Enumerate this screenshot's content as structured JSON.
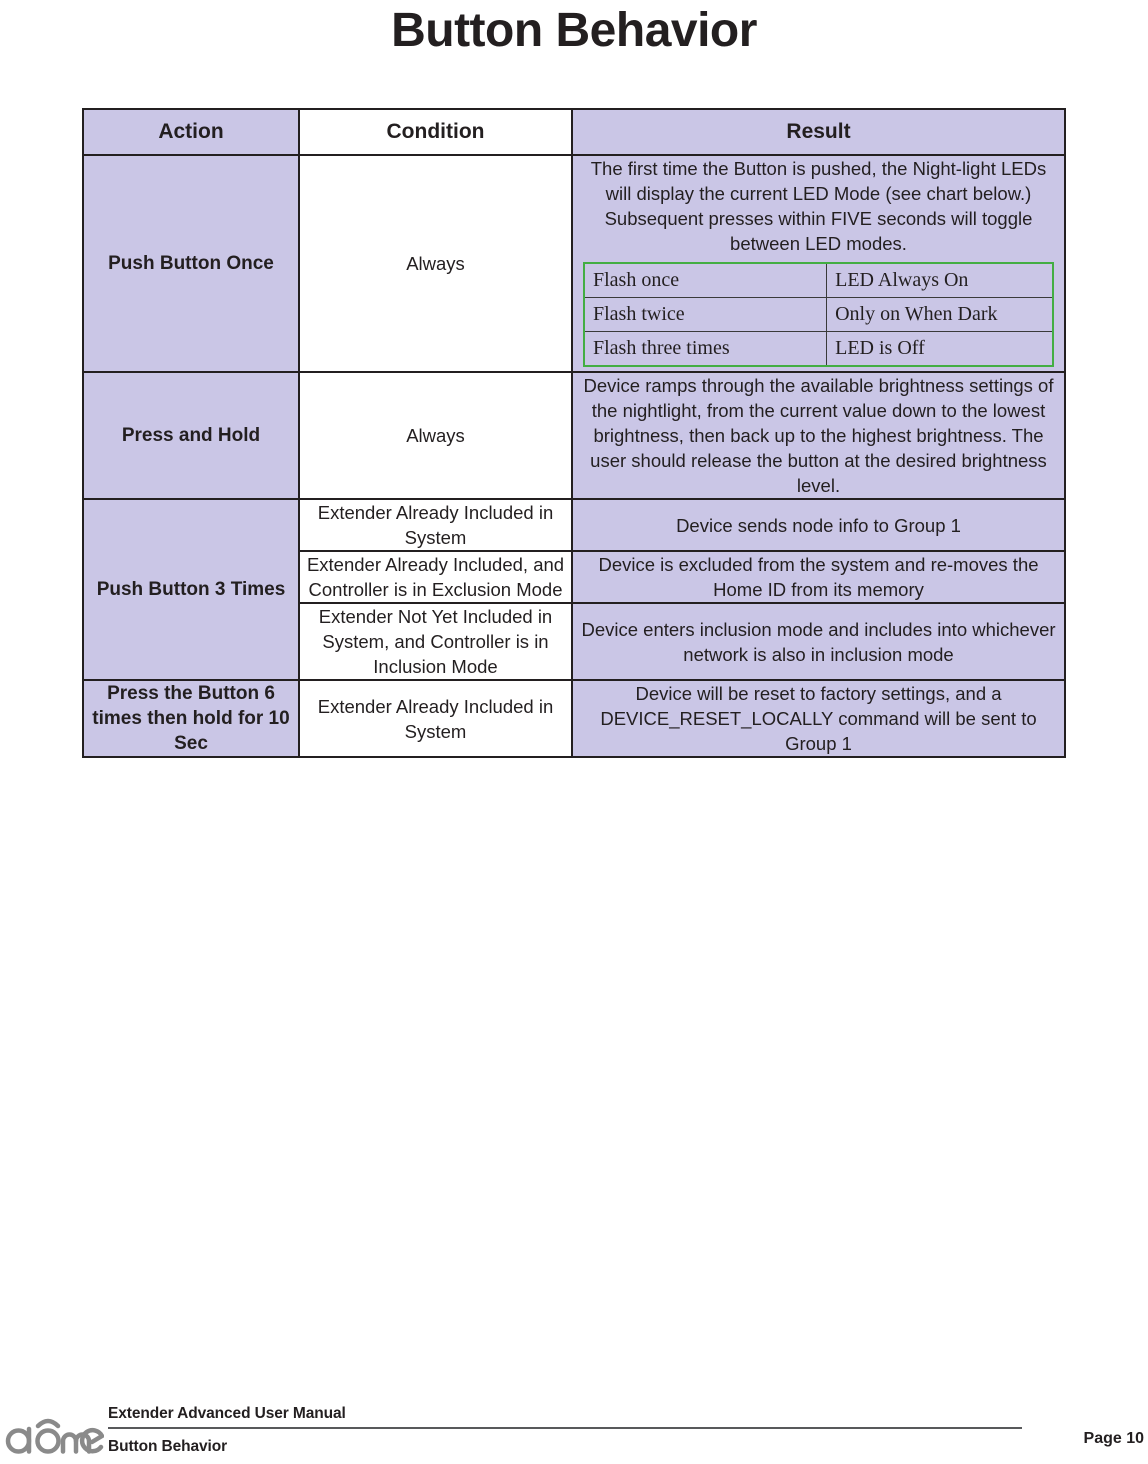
{
  "page": {
    "title": "Button Behavior"
  },
  "table": {
    "headers": {
      "action": "Action",
      "condition": "Condition",
      "result": "Result"
    },
    "rows": [
      {
        "action": "Push Button Once",
        "condition": "Always",
        "result_text": "The first time the Button is pushed, the Night-light LEDs will display the current LED Mode (see chart below.)  Subsequent presses within FIVE seconds will toggle between LED modes.",
        "led_table": {
          "border_color": "#43ae43",
          "rows": [
            {
              "flash": "Flash once",
              "mode": "LED Always On"
            },
            {
              "flash": "Flash twice",
              "mode": "Only on When Dark"
            },
            {
              "flash": "Flash three times",
              "mode": "LED is Off"
            }
          ]
        }
      },
      {
        "action": "Press and Hold",
        "condition": "Always",
        "result_text": "Device ramps through the available brightness settings of the nightlight, from the current value down to the lowest brightness, then back up to the highest brightness.  The user should release the button at the desired brightness level."
      },
      {
        "action": "Push Button 3 Times",
        "subrows": [
          {
            "condition": "Extender Already Included in System",
            "result_text": "Device sends node info to Group 1"
          },
          {
            "condition": "Extender Already Included, and Controller is in Exclusion Mode",
            "result_text": "Device is excluded from the system and re-moves the Home ID from its memory"
          },
          {
            "condition": "Extender Not Yet Included in System, and Controller is in Inclusion Mode",
            "result_text": "Device enters inclusion mode and includes into whichever network is also in inclusion mode"
          }
        ]
      },
      {
        "action": "Press the Button 6 times then hold for 10 Sec",
        "condition": "Extender Already Included in System",
        "result_text": "Device will be reset to factory settings, and a DEVICE_RESET_LOCALLY command will be sent to Group 1"
      }
    ]
  },
  "footer": {
    "logo_text": "dome",
    "manual_title": "Extender Advanced User Manual",
    "section": "Button Behavior",
    "page_label": "Page 10"
  },
  "colors": {
    "lavender": "#cac6e6",
    "ink": "#231f20",
    "green_border": "#43ae43",
    "logo_gray": "#8a8a8a",
    "rule_gray": "#58595b"
  }
}
